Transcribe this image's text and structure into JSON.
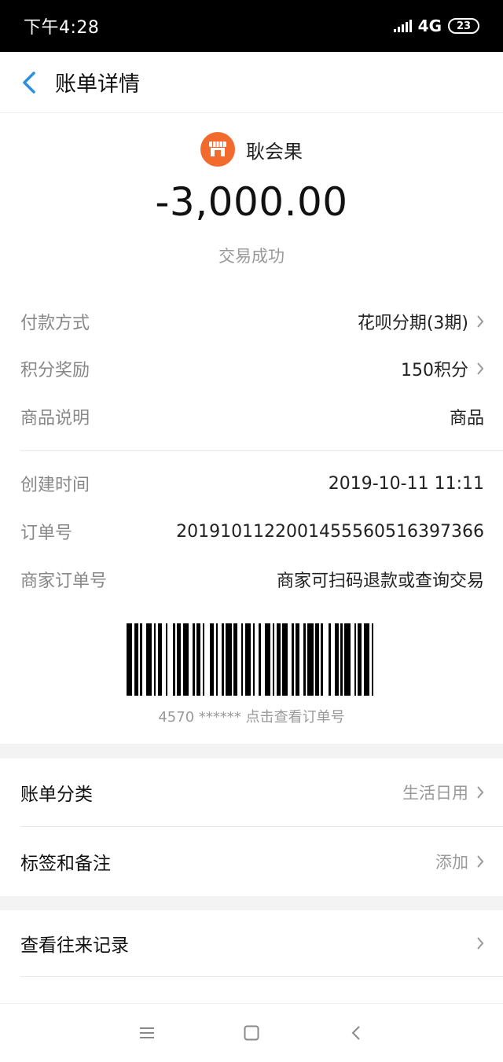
{
  "status_bar": {
    "time": "下午4:28",
    "network": "4G",
    "network_sub": "ıl",
    "battery": "23"
  },
  "nav": {
    "title": "账单详情"
  },
  "merchant": {
    "name": "耿会果",
    "icon": "shop-icon",
    "icon_color": "#f26a2e"
  },
  "transaction": {
    "amount": "-3,000.00",
    "status": "交易成功"
  },
  "details": {
    "payment_method": {
      "label": "付款方式",
      "value": "花呗分期(3期)"
    },
    "points": {
      "label": "积分奖励",
      "value": "150积分"
    },
    "description": {
      "label": "商品说明",
      "value": "商品"
    },
    "created": {
      "label": "创建时间",
      "value": "2019-10-11 11:11"
    },
    "order_no": {
      "label": "订单号",
      "value": "2019101122001455560516397366"
    },
    "merchant_order": {
      "label": "商家订单号",
      "value": "商家可扫码退款或查询交易"
    }
  },
  "barcode": {
    "caption": "4570 ****** 点击查看订单号"
  },
  "actions": {
    "category": {
      "label": "账单分类",
      "value": "生活日用"
    },
    "tags": {
      "label": "标签和备注",
      "value": "添加"
    },
    "history": {
      "label": "查看往来记录"
    }
  },
  "bottom_nav": {
    "icons": [
      "menu-icon",
      "home-icon",
      "back-icon"
    ]
  }
}
